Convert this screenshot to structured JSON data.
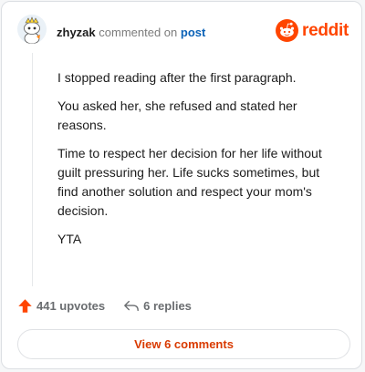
{
  "header": {
    "username": "zhyzak",
    "action_text": "commented on",
    "post_link": "post",
    "brand": "reddit"
  },
  "comment": {
    "paragraphs": [
      "I stopped reading after the first paragraph.",
      "You asked her, she refused and stated her reasons.",
      "Time to respect her decision for her life without guilt pressuring her. Life sucks sometimes, but find another solution and respect your mom's decision.",
      "YTA"
    ]
  },
  "actions": {
    "upvotes_label": "441 upvotes",
    "replies_label": "6 replies"
  },
  "footer": {
    "view_comments_label": "View 6 comments"
  },
  "colors": {
    "brand": "#ff4500",
    "link": "#0b62b7",
    "view_button_text": "#d93a00"
  },
  "icons": [
    "avatar",
    "reddit-snoo-icon",
    "upvote-arrow-icon",
    "reply-arrow-icon"
  ]
}
